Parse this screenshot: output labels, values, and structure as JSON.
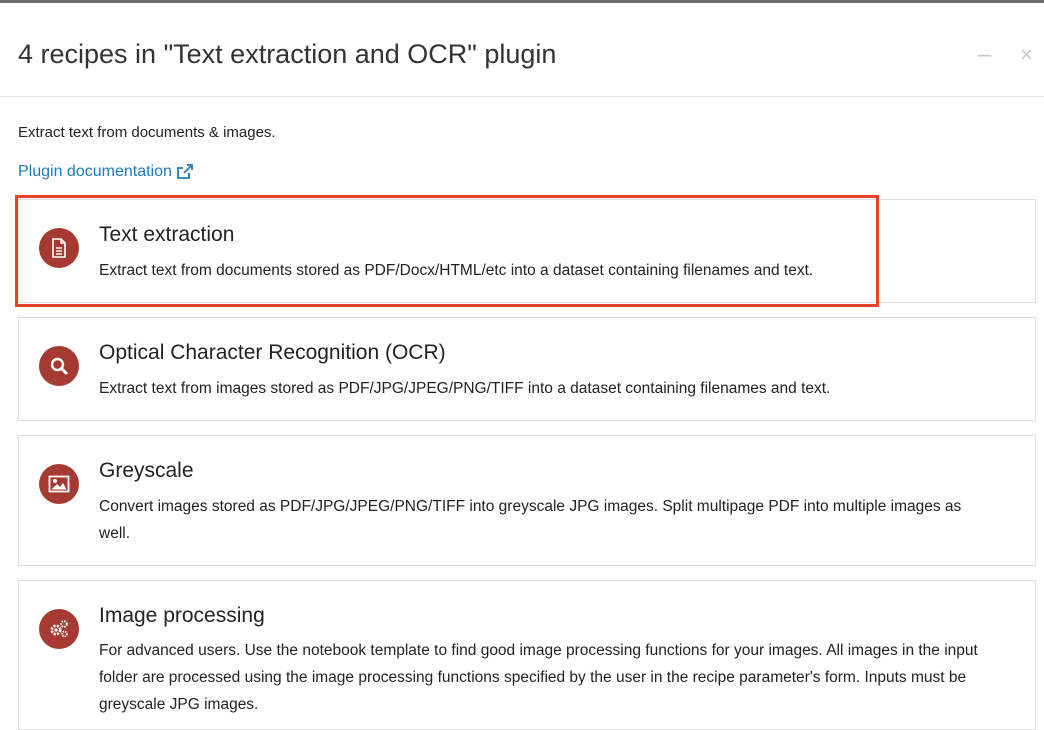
{
  "dialog": {
    "title": "4 recipes in \"Text extraction and OCR\" plugin",
    "minimize_glyph": "–",
    "close_glyph": "×",
    "description": "Extract text from documents & images.",
    "doc_link_label": "Plugin documentation",
    "doc_link_icon": "external-link-icon"
  },
  "recipes": [
    {
      "title": "Text extraction",
      "description": "Extract text from documents stored as PDF/Docx/HTML/etc into a dataset containing filenames and text.",
      "icon": "document-icon",
      "highlighted": true
    },
    {
      "title": "Optical Character Recognition (OCR)",
      "description": "Extract text from images stored as PDF/JPG/JPEG/PNG/TIFF into a dataset containing filenames and text.",
      "icon": "search-icon"
    },
    {
      "title": "Greyscale",
      "description": "Convert images stored as PDF/JPG/JPEG/PNG/TIFF into greyscale JPG images. Split multipage PDF into multiple images as well.",
      "icon": "image-icon"
    },
    {
      "title": "Image processing",
      "description": "For advanced users. Use the notebook template to find good image processing functions for your images. All images in the input folder are processed using the image processing functions specified by the user in the recipe parameter's form. Inputs must be greyscale JPG images.",
      "icon": "gears-icon"
    }
  ],
  "colors": {
    "icon_background": "#a53a33",
    "link": "#1c7bbd",
    "highlight_border": "#e8432a"
  }
}
